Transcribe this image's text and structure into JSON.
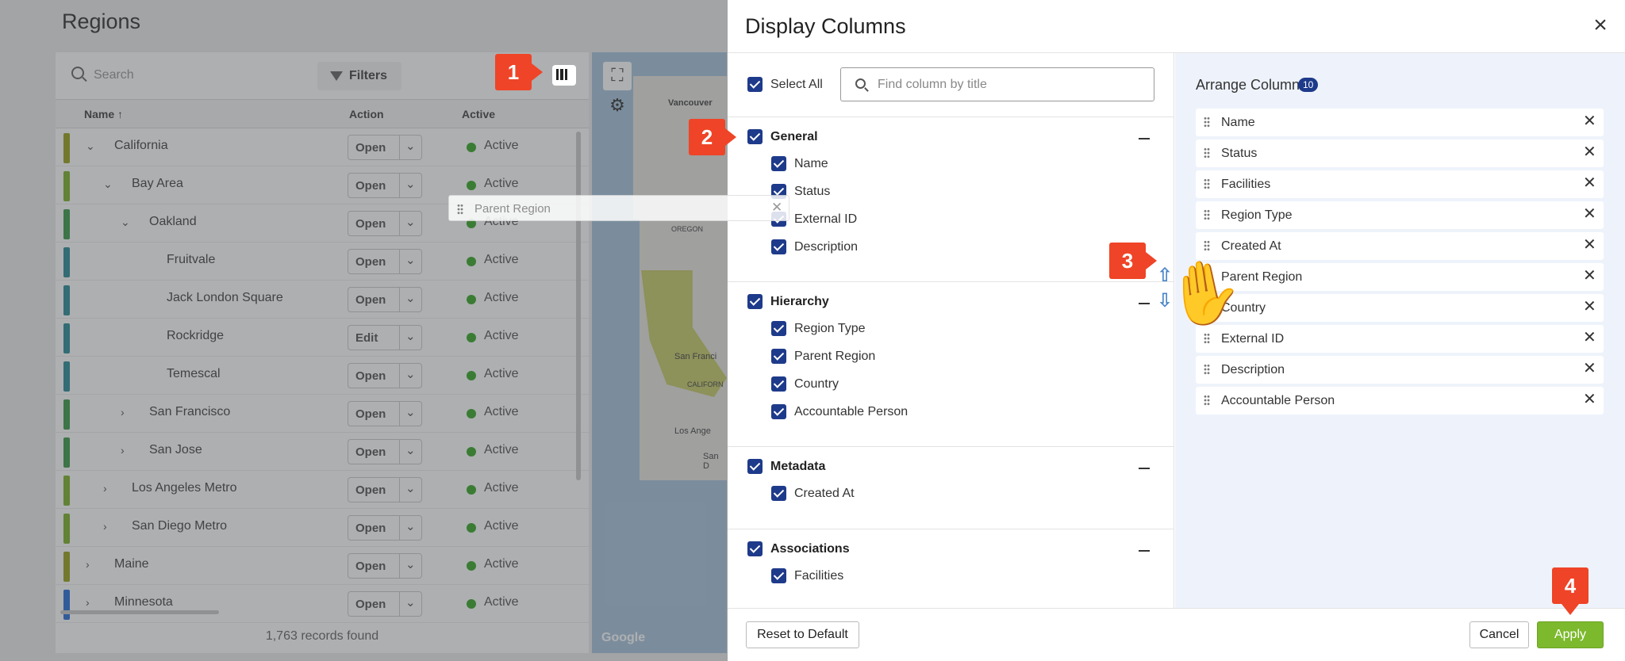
{
  "background": {
    "page_title": "Regions",
    "search_placeholder": "Search",
    "filters_label": "Filters",
    "columns": {
      "name": "Name ↑",
      "action": "Action",
      "active": "Active"
    },
    "rows": [
      {
        "name": "California",
        "action": "Open",
        "status": "Active",
        "color": "#9aa31a",
        "indent": 0,
        "chevron": "⌄"
      },
      {
        "name": "Bay Area",
        "action": "Open",
        "status": "Active",
        "color": "#7fb22a",
        "indent": 1,
        "chevron": "⌄"
      },
      {
        "name": "Oakland",
        "action": "Open",
        "status": "Active",
        "color": "#3e9a4a",
        "indent": 2,
        "chevron": "⌄"
      },
      {
        "name": "Fruitvale",
        "action": "Open",
        "status": "Active",
        "color": "#2e8c96",
        "indent": 3,
        "chevron": ""
      },
      {
        "name": "Jack London Square",
        "action": "Open",
        "status": "Active",
        "color": "#2e8c96",
        "indent": 3,
        "chevron": ""
      },
      {
        "name": "Rockridge",
        "action": "Edit",
        "status": "Active",
        "color": "#2e8c96",
        "indent": 3,
        "chevron": ""
      },
      {
        "name": "Temescal",
        "action": "Open",
        "status": "Active",
        "color": "#2e8c96",
        "indent": 3,
        "chevron": ""
      },
      {
        "name": "San Francisco",
        "action": "Open",
        "status": "Active",
        "color": "#3e9a4a",
        "indent": 2,
        "chevron": "›"
      },
      {
        "name": "San Jose",
        "action": "Open",
        "status": "Active",
        "color": "#3e9a4a",
        "indent": 2,
        "chevron": "›"
      },
      {
        "name": "Los Angeles Metro",
        "action": "Open",
        "status": "Active",
        "color": "#7fb22a",
        "indent": 1,
        "chevron": "›"
      },
      {
        "name": "San Diego Metro",
        "action": "Open",
        "status": "Active",
        "color": "#7fb22a",
        "indent": 1,
        "chevron": "›"
      },
      {
        "name": "Maine",
        "action": "Open",
        "status": "Active",
        "color": "#9aa31a",
        "indent": 0,
        "chevron": "›"
      },
      {
        "name": "Minnesota",
        "action": "Open",
        "status": "Active",
        "color": "#2b6fd8",
        "indent": 0,
        "chevron": "›"
      }
    ],
    "records_found": "1,763 records found",
    "map_labels": [
      "Vancouver",
      "OREGON",
      "San Franci",
      "CALIFORN",
      "Los Ange",
      "San D"
    ],
    "map_attribution": "Google"
  },
  "modal": {
    "title": "Display Columns",
    "select_all_label": "Select All",
    "find_placeholder": "Find column by title",
    "groups": [
      {
        "title": "General",
        "items": [
          "Name",
          "Status",
          "External ID",
          "Description"
        ]
      },
      {
        "title": "Hierarchy",
        "items": [
          "Region Type",
          "Parent Region",
          "Country",
          "Accountable Person"
        ]
      },
      {
        "title": "Metadata",
        "items": [
          "Created At"
        ]
      },
      {
        "title": "Associations",
        "items": [
          "Facilities"
        ]
      }
    ],
    "arrange_title": "Arrange Columns",
    "arrange_count": "10",
    "arranged_columns": [
      "Name",
      "Status",
      "Facilities",
      "Region Type",
      "Created At",
      "Parent Region",
      "Country",
      "External ID",
      "Description",
      "Accountable Person"
    ],
    "dragging_item": "Parent Region",
    "remove_symbol": "✕",
    "close_symbol": "×",
    "reset_label": "Reset to Default",
    "cancel_label": "Cancel",
    "apply_label": "Apply"
  },
  "annotations": {
    "callout_1": "1",
    "callout_2": "2",
    "callout_3": "3",
    "callout_4": "4"
  },
  "colors": {
    "accent": "#1e3a8a",
    "apply_green": "#7cb92d",
    "callout_red": "#ef4427",
    "active_green": "#3aa827"
  }
}
